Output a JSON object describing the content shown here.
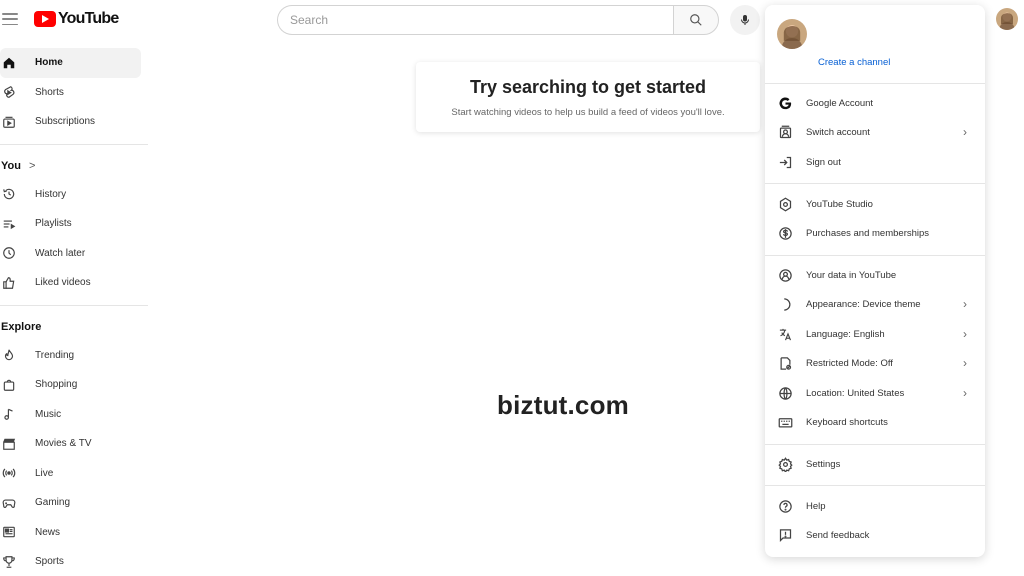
{
  "header": {
    "logo_text": "YouTube",
    "search_placeholder": "Search"
  },
  "sidebar": {
    "main": [
      {
        "label": "Home",
        "icon": "home-icon",
        "active": true
      },
      {
        "label": "Shorts",
        "icon": "shorts-icon"
      },
      {
        "label": "Subscriptions",
        "icon": "subscriptions-icon"
      }
    ],
    "you_title": "You",
    "you_chevron": ">",
    "you": [
      {
        "label": "History",
        "icon": "history-icon"
      },
      {
        "label": "Playlists",
        "icon": "playlists-icon"
      },
      {
        "label": "Watch later",
        "icon": "clock-icon"
      },
      {
        "label": "Liked videos",
        "icon": "thumbs-up-icon"
      }
    ],
    "explore_title": "Explore",
    "explore": [
      {
        "label": "Trending",
        "icon": "trending-icon"
      },
      {
        "label": "Shopping",
        "icon": "shopping-bag-icon"
      },
      {
        "label": "Music",
        "icon": "music-note-icon"
      },
      {
        "label": "Movies & TV",
        "icon": "clapperboard-icon"
      },
      {
        "label": "Live",
        "icon": "live-icon"
      },
      {
        "label": "Gaming",
        "icon": "gamepad-icon"
      },
      {
        "label": "News",
        "icon": "newspaper-icon"
      },
      {
        "label": "Sports",
        "icon": "trophy-icon"
      }
    ]
  },
  "main": {
    "hint_title": "Try searching to get started",
    "hint_subtitle": "Start watching videos to help us build a feed of videos you'll love."
  },
  "watermark": "biztut.com",
  "account_menu": {
    "create_channel": "Create a channel",
    "items": [
      {
        "label": "Google Account",
        "icon": "google-icon"
      },
      {
        "label": "Switch account",
        "icon": "switch-account-icon",
        "chevron": true
      },
      {
        "label": "Sign out",
        "icon": "sign-out-icon"
      },
      {
        "label": "YouTube Studio",
        "icon": "studio-icon"
      },
      {
        "label": "Purchases and memberships",
        "icon": "dollar-icon"
      },
      {
        "label": "Your data in YouTube",
        "icon": "user-shield-icon"
      },
      {
        "label": "Appearance: Device theme",
        "icon": "moon-icon",
        "chevron": true
      },
      {
        "label": "Language: English",
        "icon": "translate-icon",
        "chevron": true
      },
      {
        "label": "Restricted Mode: Off",
        "icon": "restricted-icon",
        "chevron": true
      },
      {
        "label": "Location: United States",
        "icon": "globe-icon",
        "chevron": true
      },
      {
        "label": "Keyboard shortcuts",
        "icon": "keyboard-icon"
      },
      {
        "label": "Settings",
        "icon": "gear-icon"
      },
      {
        "label": "Help",
        "icon": "help-icon"
      },
      {
        "label": "Send feedback",
        "icon": "feedback-icon"
      }
    ]
  },
  "colors": {
    "brand_red": "#ff0000",
    "link_blue": "#065fd4"
  }
}
